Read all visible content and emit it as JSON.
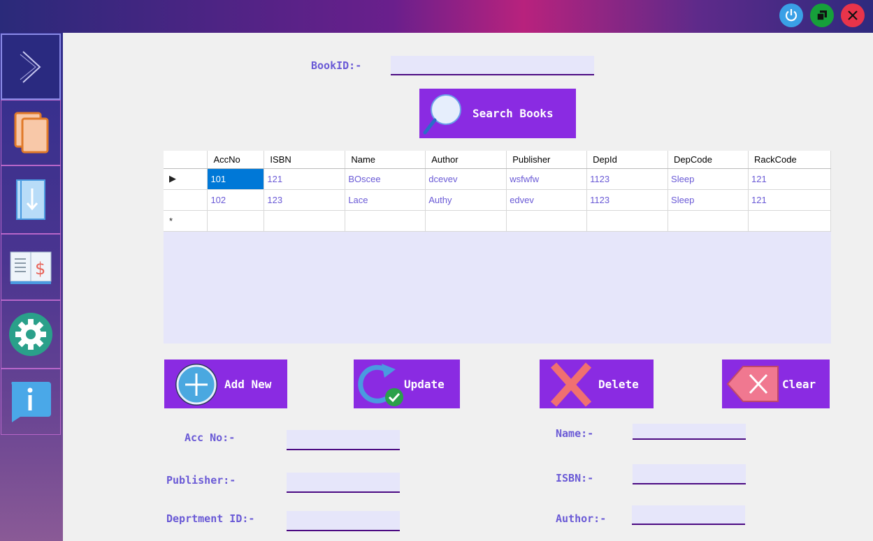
{
  "window": {
    "power_icon": "power-icon",
    "restore_icon": "restore-icon",
    "close_icon": "close-icon"
  },
  "sidebar": {
    "items": [
      {
        "icon": "chevron-right-icon"
      },
      {
        "icon": "books-icon"
      },
      {
        "icon": "download-book-icon"
      },
      {
        "icon": "book-price-icon"
      },
      {
        "icon": "gear-icon"
      },
      {
        "icon": "info-icon"
      }
    ]
  },
  "search": {
    "label": "BookID:-",
    "value": "",
    "button_label": "Search Books"
  },
  "grid": {
    "columns": [
      "",
      "AccNo",
      "ISBN",
      "Name",
      "Author",
      "Publisher",
      "DepId",
      "DepCode",
      "RackCode"
    ],
    "rows": [
      {
        "marker": "▶",
        "cells": [
          "101",
          "121",
          "BOscee",
          "dcevev",
          "wsfwfw",
          "1123",
          "Sleep",
          "121"
        ]
      },
      {
        "marker": "",
        "cells": [
          "102",
          "123",
          "Lace",
          "Authy",
          "edvev",
          "1123",
          "Sleep",
          "121"
        ]
      },
      {
        "marker": "*",
        "cells": [
          "",
          "",
          "",
          "",
          "",
          "",
          "",
          ""
        ]
      }
    ]
  },
  "actions": {
    "add": "Add New",
    "update": "Update",
    "delete": "Delete",
    "clear": "Clear"
  },
  "form": {
    "acc_no_label": "Acc No:-",
    "publisher_label": "Publisher:-",
    "dept_label": "Deprtment ID:-",
    "name_label": "Name:-",
    "isbn_label": "ISBN:-",
    "author_label": "Author:-"
  },
  "colors": {
    "accent": "#8a2be2",
    "label": "#6a5ad6",
    "input_bg": "#e6e6fa",
    "underline": "#4b0a82"
  }
}
